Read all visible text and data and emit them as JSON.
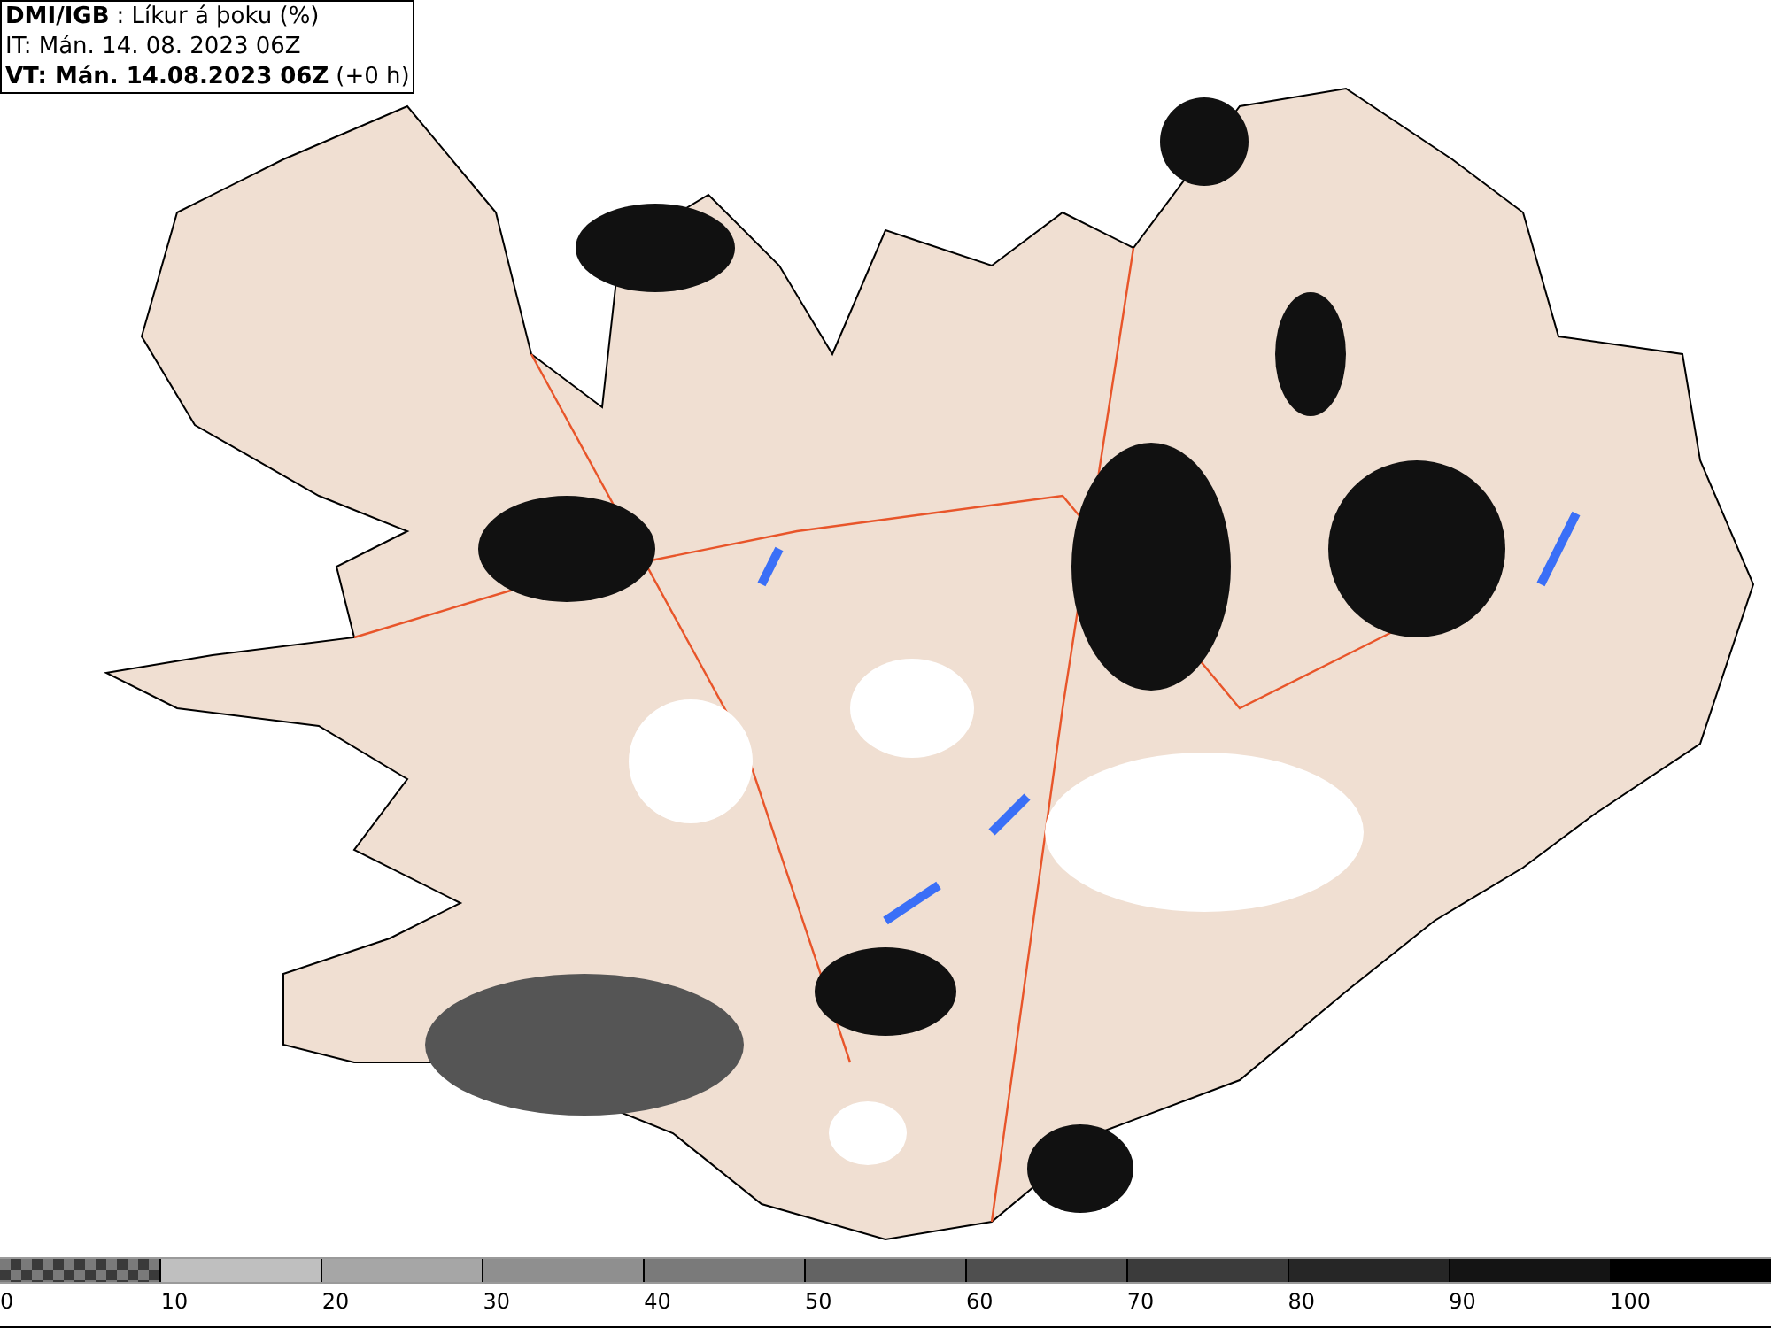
{
  "legend": {
    "source": "DMI/IGB",
    "title": ": Líkur á þoku (%)",
    "issued": "IT: Mán. 14. 08. 2023 06Z",
    "valid": "VT: Mán. 14.08.2023 06Z",
    "offset": "(+0 h)"
  },
  "colorbar": {
    "segments": [
      {
        "kind": "checker",
        "color": "#7a7a7a"
      },
      {
        "kind": "solid",
        "color": "#bfbfbf"
      },
      {
        "kind": "solid",
        "color": "#a6a6a6"
      },
      {
        "kind": "solid",
        "color": "#8f8f8f"
      },
      {
        "kind": "solid",
        "color": "#7a7a7a"
      },
      {
        "kind": "solid",
        "color": "#636363"
      },
      {
        "kind": "solid",
        "color": "#4f4f4f"
      },
      {
        "kind": "solid",
        "color": "#3b3b3b"
      },
      {
        "kind": "solid",
        "color": "#262626"
      },
      {
        "kind": "solid",
        "color": "#141414"
      },
      {
        "kind": "solid",
        "color": "#000000"
      }
    ],
    "labels": [
      "0",
      "10",
      "20",
      "30",
      "40",
      "50",
      "60",
      "70",
      "80",
      "90",
      "100"
    ]
  }
}
